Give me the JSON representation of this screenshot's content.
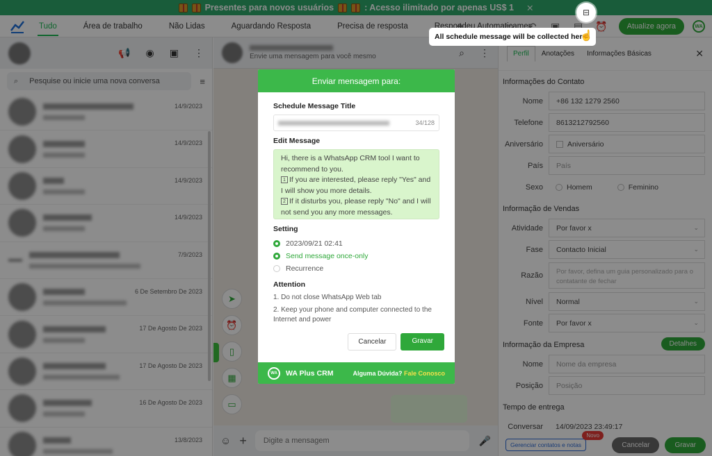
{
  "promo": {
    "text": "Presentes para novos usuários",
    "text2": ": Acesso ilimitado por apenas US$ 1",
    "close": "✕"
  },
  "tabs": [
    {
      "label": "Tudo",
      "active": true
    },
    {
      "label": "Área de trabalho"
    },
    {
      "label": "Não Lidas"
    },
    {
      "label": "Aguardando Resposta"
    },
    {
      "label": "Precisa de resposta"
    },
    {
      "label": "Respondeu Automaticamer"
    }
  ],
  "toolbar": {
    "update_label": "Atualize agora",
    "wa_badge": "WA"
  },
  "tooltip": {
    "text": "All schedule message will be collected here"
  },
  "search": {
    "placeholder": "Pesquise ou inicie uma nova conversa"
  },
  "chats": [
    {
      "date": "14/9/2023"
    },
    {
      "date": "14/9/2023"
    },
    {
      "date": "14/9/2023"
    },
    {
      "date": "14/9/2023"
    },
    {
      "date": "7/9/2023"
    },
    {
      "date": "6 De Setembro De 2023"
    },
    {
      "date": "17 De Agosto De 2023"
    },
    {
      "date": "17 De Agosto De 2023"
    },
    {
      "date": "16 De Agosto De 2023"
    },
    {
      "date": "13/8/2023"
    }
  ],
  "chat_header": {
    "subtitle": "Envie uma mensagem para você mesmo"
  },
  "compose": {
    "placeholder": "Digite a mensagem"
  },
  "modal": {
    "title": "Enviar mensagem para:",
    "schedule_title_label": "Schedule Message Title",
    "counter": "34/128",
    "edit_label": "Edit Message",
    "message_line1": "Hi, there is a WhatsApp CRM tool I want to recommend to you.",
    "message_line2": "If you are interested, please reply \"Yes\" and I will show you more details.",
    "message_line3": "If it disturbs you, please reply \"No\" and I will not send you any more messages.",
    "box1": "1",
    "box2": "2",
    "setting_label": "Setting",
    "datetime": "2023/09/21 02:41",
    "once_only": "Send message once-only",
    "recurrence": "Recurrence",
    "attention_label": "Attention",
    "attention1": "1. Do not close WhatsApp Web tab",
    "attention2": "2. Keep your phone and computer connected to the Internet and power",
    "cancel": "Cancelar",
    "save": "Gravar",
    "footer_brand": "WA Plus CRM",
    "footer_logo": "WA",
    "footer_help": "Alguma Dúvida?",
    "footer_link": "Fale Conosco"
  },
  "right": {
    "tabs": [
      "Perfil",
      "Anotações",
      "Informações Básicas"
    ],
    "contact_section": "Informações do Contato",
    "name_label": "Nome",
    "name_value": "+86 132 1279 2560",
    "phone_label": "Telefone",
    "phone_value": "8613212792560",
    "birthday_label": "Aniversário",
    "birthday_value": "Aniversário",
    "country_label": "País",
    "country_placeholder": "País",
    "sex_label": "Sexo",
    "male": "Homem",
    "female": "Feminino",
    "sales_section": "Informação de Vendas",
    "activity_label": "Atividade",
    "activity_value": "Por favor x",
    "phase_label": "Fase",
    "phase_value": "Contacto Inicial",
    "reason_label": "Razão",
    "reason_placeholder": "Por favor, defina um guia personalizado para o contatante de fechar",
    "level_label": "Nível",
    "level_value": "Normal",
    "source_label": "Fonte",
    "source_value": "Por favor x",
    "company_section": "Informação da Empresa",
    "details_button": "Detalhes",
    "company_name_label": "Nome",
    "company_name_placeholder": "Nome da empresa",
    "position_label": "Posição",
    "position_placeholder": "Posição",
    "delivery_section": "Tempo de entrega",
    "talk_label": "Conversar",
    "talk_value": "14/09/2023 23:49:17",
    "generate_button": "Gerenciar contatos e notas",
    "new_badge": "Novo",
    "cancel": "Cancelar",
    "save": "Gravar"
  }
}
